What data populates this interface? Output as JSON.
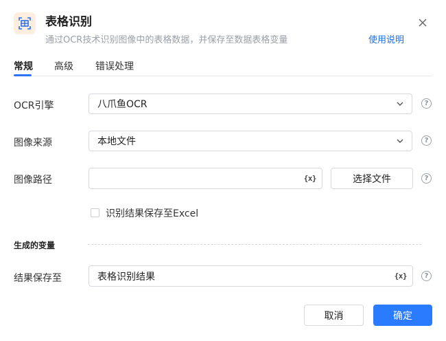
{
  "header": {
    "title": "表格识别",
    "subtitle": "通过OCR技术识别图像中的表格数据，并保存至数据表格变量",
    "help_link": "使用说明",
    "icon": "table-icon",
    "accent_color": "#2b7bff"
  },
  "tabs": [
    {
      "label": "常规",
      "active": true
    },
    {
      "label": "高级",
      "active": false
    },
    {
      "label": "错误处理",
      "active": false
    }
  ],
  "form": {
    "ocr_engine": {
      "label": "OCR引擎",
      "value": "八爪鱼OCR"
    },
    "image_source": {
      "label": "图像来源",
      "value": "本地文件"
    },
    "image_path": {
      "label": "图像路径",
      "value": "",
      "var_button": "{x}",
      "choose_file_button": "选择文件"
    },
    "save_excel": {
      "label": "识别结果保存至Excel",
      "checked": false
    }
  },
  "variables": {
    "section_title": "生成的变量",
    "result": {
      "label": "结果保存至",
      "value": "表格识别结果",
      "var_button": "{x}"
    }
  },
  "footer": {
    "cancel_label": "取消",
    "ok_label": "确定"
  }
}
